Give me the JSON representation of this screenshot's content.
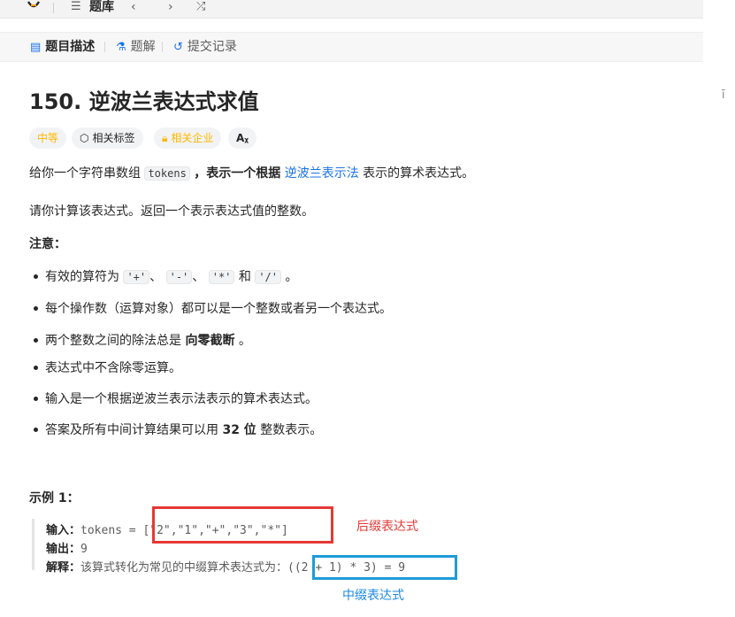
{
  "topbar": {
    "logo_icon": "leetcode-logo-icon",
    "list_icon": "list-icon",
    "problem_bank": "题库",
    "prev": "‹",
    "next": "›",
    "random_icon": "shuffle-icon"
  },
  "tabs": {
    "description": "题目描述",
    "solutions": "题解",
    "submissions": "提交记录"
  },
  "edge_char": "ī",
  "problem": {
    "title": "150. 逆波兰表达式求值",
    "difficulty": "中等",
    "related_tags": "相关标签",
    "related_companies": "相关企业",
    "translate": "Aᵪ"
  },
  "description": {
    "line1_pre": "给你一个字符串数组",
    "line1_code": "tokens",
    "line1_mid": "，表示一个根据",
    "line1_link": "逆波兰表示法",
    "line1_post": "表示的算术表达式。",
    "line2": "请你计算该表达式。返回一个表示表达式值的整数。",
    "note_title": "注意："
  },
  "notes": {
    "n1_pre": "有效的算符为",
    "op_plus": "'+'",
    "op_minus": "'-'",
    "op_mul": "'*'",
    "op_div": "'/'",
    "sep1": "、",
    "sep2": "、",
    "and": "和",
    "end": "。",
    "n2": "每个操作数（运算对象）都可以是一个整数或者另一个表达式。",
    "n3_pre": "两个整数之间的除法总是",
    "n3_bold": "向零截断",
    "n3_post": "。",
    "n4": "表达式中不含除零运算。",
    "n5": "输入是一个根据逆波兰表示法表示的算术表达式。",
    "n6_pre": "答案及所有中间计算结果可以用",
    "n6_bold": "32 位",
    "n6_post": "整数表示。"
  },
  "example": {
    "title": "示例 1：",
    "input_label": "输入：",
    "input_value": "tokens = [\"2\",\"1\",\"+\",\"3\",\"*\"]",
    "output_label": "输出：",
    "output_value": "9",
    "explain_label": "解释：",
    "explain_value": "该算式转化为常见的中缀算术表达式为：((2 + 1) * 3) = 9"
  },
  "annotations": {
    "postfix": "后缀表达式",
    "infix": "中缀表达式",
    "red_color": "#e53935",
    "blue_color": "#1e9bd7"
  },
  "colors": {
    "link": "#1a73e8",
    "difficulty_medium": "#ffb800"
  }
}
